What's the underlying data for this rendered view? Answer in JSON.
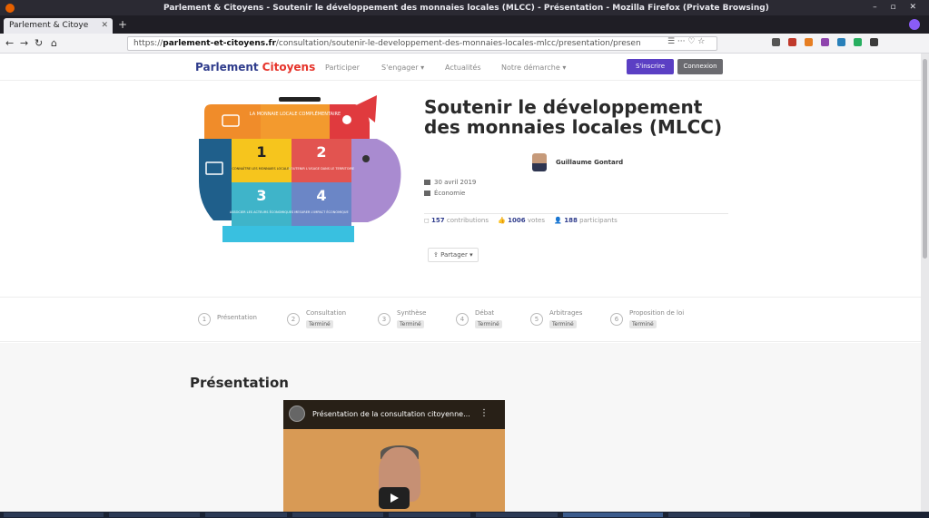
{
  "browser": {
    "window_title": "Parlement & Citoyens - Soutenir le développement des monnaies locales (MLCC) - Présentation - Mozilla Firefox (Private Browsing)",
    "tab_label": "Parlement & Citoye",
    "url_prefix": "https://",
    "url_domain": "parlement-et-citoyens.fr",
    "url_path": "/consultation/soutenir-le-developpement-des-monnaies-locales-mlcc/presentation/presen",
    "url_icons": "☰ ··· ♡ ☆"
  },
  "site": {
    "logo_part1": "Parlement",
    "logo_part2": "Citoyens",
    "nav": [
      "Participer",
      "S'engager ▾",
      "Actualités",
      "Notre démarche ▾"
    ],
    "signin": "S'inscrire",
    "signup": "Connexion"
  },
  "consultation": {
    "title": "Soutenir le développement des monnaies locales (MLCC)",
    "author": "Guillaume Gontard",
    "date": "30 avril 2019",
    "theme": "Économie",
    "stats": [
      {
        "value": "157",
        "label": "contributions"
      },
      {
        "value": "1006",
        "label": "votes"
      },
      {
        "value": "188",
        "label": "participants"
      }
    ],
    "share": "Partager ▾"
  },
  "illustration": {
    "piece1": "LA MONNAIE LOCALE COMPLÉMENTAIRE",
    "piece2_num": "1",
    "piece2_text": "CONNAÎTRE LES MONNAIES LOCALES",
    "piece3_num": "2",
    "piece3_text": "SOUTENIR L'USAGE DANS LE TERRITOIRE",
    "piece4_num": "3",
    "piece4_text": "ASSOCIER LES ACTEURS ÉCONOMIQUES",
    "piece5_num": "4",
    "piece5_text": "MESURER L'IMPACT ÉCONOMIQUE"
  },
  "steps": [
    {
      "num": "1",
      "label": "Présentation",
      "badge": ""
    },
    {
      "num": "2",
      "label": "Consultation",
      "badge": "Terminé"
    },
    {
      "num": "3",
      "label": "Synthèse",
      "badge": "Terminé"
    },
    {
      "num": "4",
      "label": "Débat",
      "badge": "Terminé"
    },
    {
      "num": "5",
      "label": "Arbitrages",
      "badge": "Terminé"
    },
    {
      "num": "6",
      "label": "Proposition de loi",
      "badge": "Terminé"
    }
  ],
  "section": {
    "title": "Présentation",
    "video_title": "Présentation de la consultation citoyenne..."
  },
  "colors": {
    "brand_blue": "#2f3c8c",
    "brand_red": "#e6332a",
    "accent_purple": "#5b3fc4"
  }
}
